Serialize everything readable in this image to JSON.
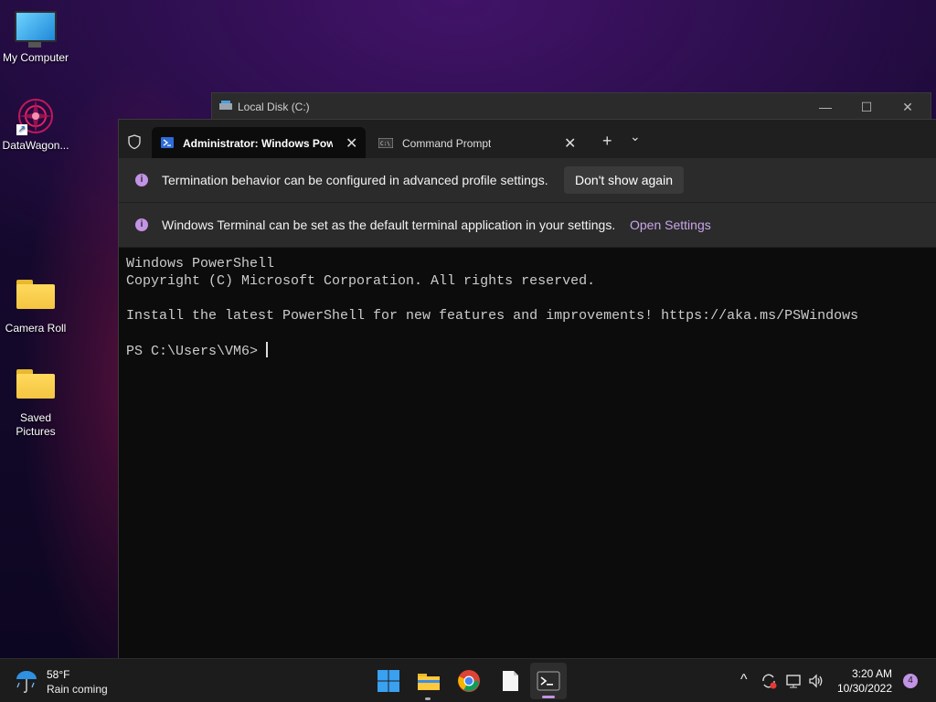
{
  "desktop": {
    "icons": [
      {
        "label": "My Computer"
      },
      {
        "label": "DataWagon..."
      },
      {
        "label": "Camera Roll"
      },
      {
        "label": "Saved\nPictures"
      }
    ]
  },
  "explorer_window": {
    "title": "Local Disk (C:)",
    "minimize": "—",
    "maximize": "☐",
    "close": "✕"
  },
  "terminal": {
    "tabs": [
      {
        "label": "Administrator: Windows PowerShell",
        "active": true
      },
      {
        "label": "Command Prompt",
        "active": false
      }
    ],
    "tab_close": "✕",
    "new_tab": "+",
    "dropdown": "⌄",
    "infobars": [
      {
        "message": "Termination behavior can be configured in advanced profile settings.",
        "action": "Don't show again"
      },
      {
        "message": "Windows Terminal can be set as the default terminal application in your settings.",
        "action": "Open Settings"
      }
    ],
    "console_lines": [
      "Windows PowerShell",
      "Copyright (C) Microsoft Corporation. All rights reserved.",
      "",
      "Install the latest PowerShell for new features and improvements! https://aka.ms/PSWindows",
      ""
    ],
    "prompt": "PS C:\\Users\\VM6> "
  },
  "taskbar": {
    "weather": {
      "temp": "58°F",
      "condition": "Rain coming"
    },
    "apps": [
      "start-icon",
      "file-explorer-icon",
      "chrome-icon",
      "notepad-icon",
      "terminal-icon"
    ],
    "tray": {
      "chevron": "^"
    },
    "clock": {
      "time": "3:20 AM",
      "date": "10/30/2022"
    },
    "notifications": "4"
  },
  "colors": {
    "accent": "#c393e6",
    "terminal_bg": "#0c0c0c",
    "tabbar_bg": "#1f1f1f"
  }
}
